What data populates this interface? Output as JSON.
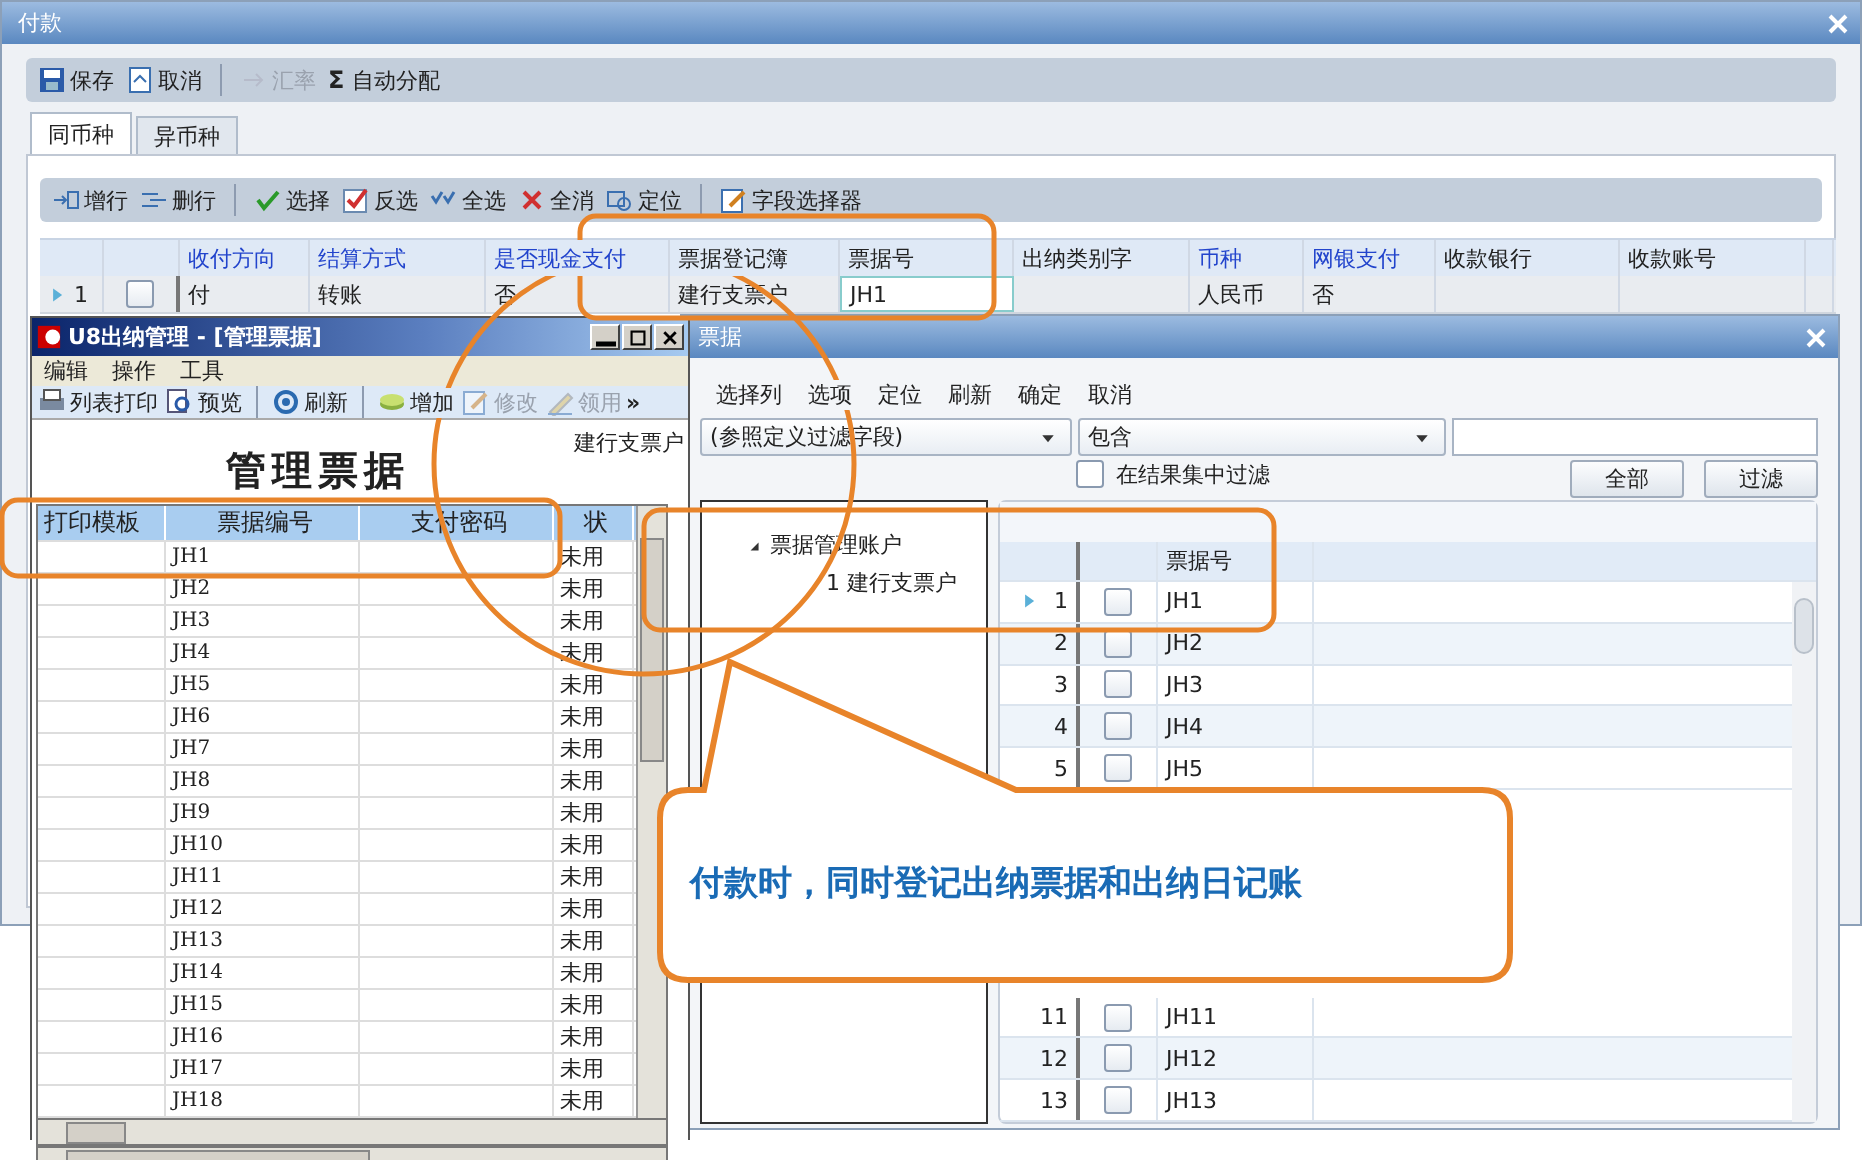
{
  "payment_window": {
    "title": "付款",
    "toolbar": [
      {
        "label": "保存",
        "disabled": false
      },
      {
        "label": "取消",
        "disabled": false
      },
      {
        "label": "汇率",
        "disabled": true
      },
      {
        "label": "自动分配",
        "symbol": "Σ",
        "disabled": false
      }
    ],
    "tabs": [
      {
        "label": "同币种",
        "selected": true
      },
      {
        "label": "异币种",
        "selected": false
      }
    ],
    "grid_toolbar": [
      "增行",
      "删行",
      "选择",
      "反选",
      "全选",
      "全消",
      "定位",
      "字段选择器"
    ],
    "table": {
      "columns": [
        {
          "label": "收付方向",
          "required": true
        },
        {
          "label": "结算方式",
          "required": true
        },
        {
          "label": "是否现金支付",
          "required": true
        },
        {
          "label": "票据登记簿",
          "required": false
        },
        {
          "label": "票据号",
          "required": false
        },
        {
          "label": "出纳类别字",
          "required": false
        },
        {
          "label": "币种",
          "required": true
        },
        {
          "label": "网银支付",
          "required": true
        },
        {
          "label": "收款银行",
          "required": false
        },
        {
          "label": "收款账号",
          "required": false
        }
      ],
      "rows": [
        {
          "number": "1",
          "current": true,
          "checked": false,
          "cells": [
            "付",
            "转账",
            "否",
            "建行支票户",
            "JH1",
            "",
            "人民币",
            "否",
            "",
            ""
          ]
        }
      ]
    }
  },
  "cashier_window": {
    "title": "U8出纳管理 - [管理票据]",
    "menu": [
      "编辑",
      "操作",
      "工具"
    ],
    "toolbar": [
      {
        "label": "列表打印",
        "disabled": false
      },
      {
        "label": "预览",
        "disabled": false
      },
      {
        "label": "刷新",
        "disabled": false
      },
      {
        "label": "增加",
        "disabled": false
      },
      {
        "label": "修改",
        "disabled": true
      },
      {
        "label": "领用",
        "disabled": true
      }
    ],
    "toolbar_more": "»",
    "heading": "管理票据",
    "account": "建行支票户",
    "table": {
      "columns": [
        "打印模板",
        "票据编号",
        "支付密码",
        "状"
      ],
      "rows": [
        [
          "",
          "JH1",
          "",
          "未用"
        ],
        [
          "",
          "JH2",
          "",
          "未用"
        ],
        [
          "",
          "JH3",
          "",
          "未用"
        ],
        [
          "",
          "JH4",
          "",
          "未用"
        ],
        [
          "",
          "JH5",
          "",
          "未用"
        ],
        [
          "",
          "JH6",
          "",
          "未用"
        ],
        [
          "",
          "JH7",
          "",
          "未用"
        ],
        [
          "",
          "JH8",
          "",
          "未用"
        ],
        [
          "",
          "JH9",
          "",
          "未用"
        ],
        [
          "",
          "JH10",
          "",
          "未用"
        ],
        [
          "",
          "JH11",
          "",
          "未用"
        ],
        [
          "",
          "JH12",
          "",
          "未用"
        ],
        [
          "",
          "JH13",
          "",
          "未用"
        ],
        [
          "",
          "JH14",
          "",
          "未用"
        ],
        [
          "",
          "JH15",
          "",
          "未用"
        ],
        [
          "",
          "JH16",
          "",
          "未用"
        ],
        [
          "",
          "JH17",
          "",
          "未用"
        ],
        [
          "",
          "JH18",
          "",
          "未用"
        ]
      ]
    }
  },
  "bill_window": {
    "title": "票据",
    "menu": [
      "选择列",
      "选项",
      "定位",
      "刷新",
      "确定",
      "取消"
    ],
    "filter": {
      "field": "(参照定义过滤字段)",
      "operator": "包含"
    },
    "filter_in_results": {
      "label": "在结果集中过滤",
      "checked": false
    },
    "buttons": [
      "全部",
      "过滤"
    ],
    "tree": [
      {
        "label": "票据管理账户",
        "expanded": true,
        "children": [
          {
            "label": "1 建行支票户"
          }
        ]
      }
    ],
    "grid": {
      "column": "票据号",
      "rows_top": [
        {
          "number": "1",
          "current": true,
          "checked": false,
          "label": "JH1"
        },
        {
          "number": "2",
          "current": false,
          "checked": false,
          "label": "JH2"
        },
        {
          "number": "3",
          "current": false,
          "checked": false,
          "label": "JH3"
        },
        {
          "number": "4",
          "current": false,
          "checked": false,
          "label": "JH4"
        },
        {
          "number": "5",
          "current": false,
          "checked": false,
          "label": "JH5"
        }
      ],
      "rows_bottom": [
        {
          "number": "11",
          "current": false,
          "checked": false,
          "label": "JH11"
        },
        {
          "number": "12",
          "current": false,
          "checked": false,
          "label": "JH12"
        },
        {
          "number": "13",
          "current": false,
          "checked": false,
          "label": "JH13"
        }
      ]
    }
  },
  "callout": {
    "text": "付款时，同时登记出纳票据和出纳日记账"
  }
}
